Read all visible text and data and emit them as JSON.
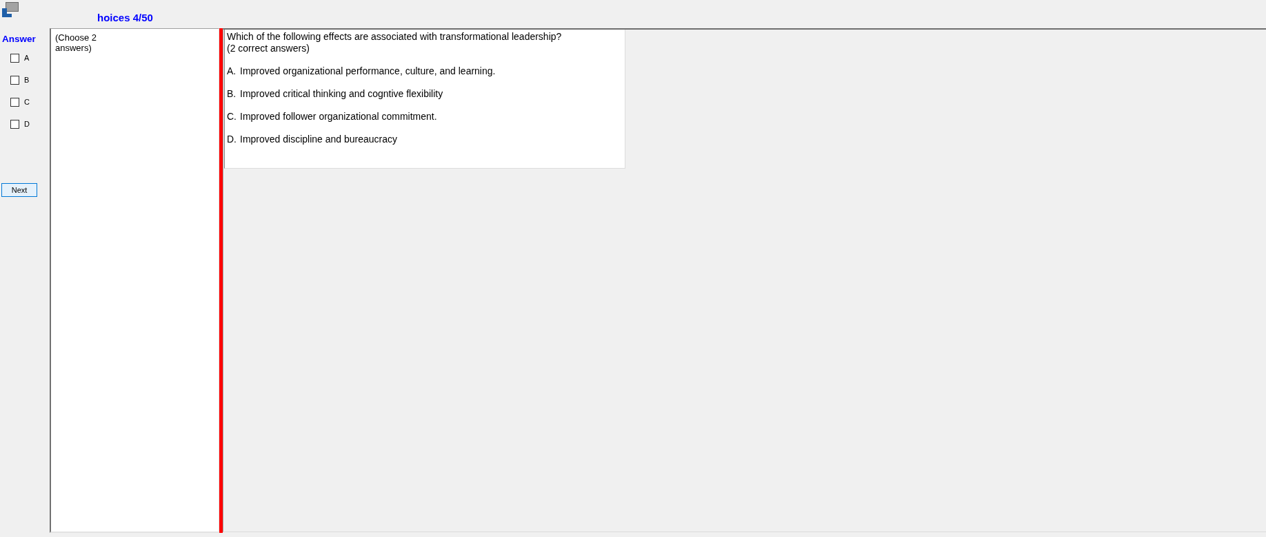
{
  "window": {
    "title": "hoices 4/50"
  },
  "answer_panel": {
    "heading": "Answer",
    "options": [
      {
        "label": "A",
        "checked": false
      },
      {
        "label": "B",
        "checked": false
      },
      {
        "label": "C",
        "checked": false
      },
      {
        "label": "D",
        "checked": false
      }
    ],
    "next_button": "Next"
  },
  "instruction": "(Choose 2 answers)",
  "question": {
    "lines": [
      "Which of the following effects are associated with transformational leadership?",
      "(2 correct answers)"
    ],
    "options": [
      {
        "letter": "A.",
        "text": "Improved organizational performance, culture, and learning."
      },
      {
        "letter": "B.",
        "text": "Improved critical thinking and cogntive flexibility"
      },
      {
        "letter": "C.",
        "text": "Improved follower organizational commitment."
      },
      {
        "letter": "D.",
        "text": "Improved discipline and bureaucracy"
      }
    ]
  }
}
